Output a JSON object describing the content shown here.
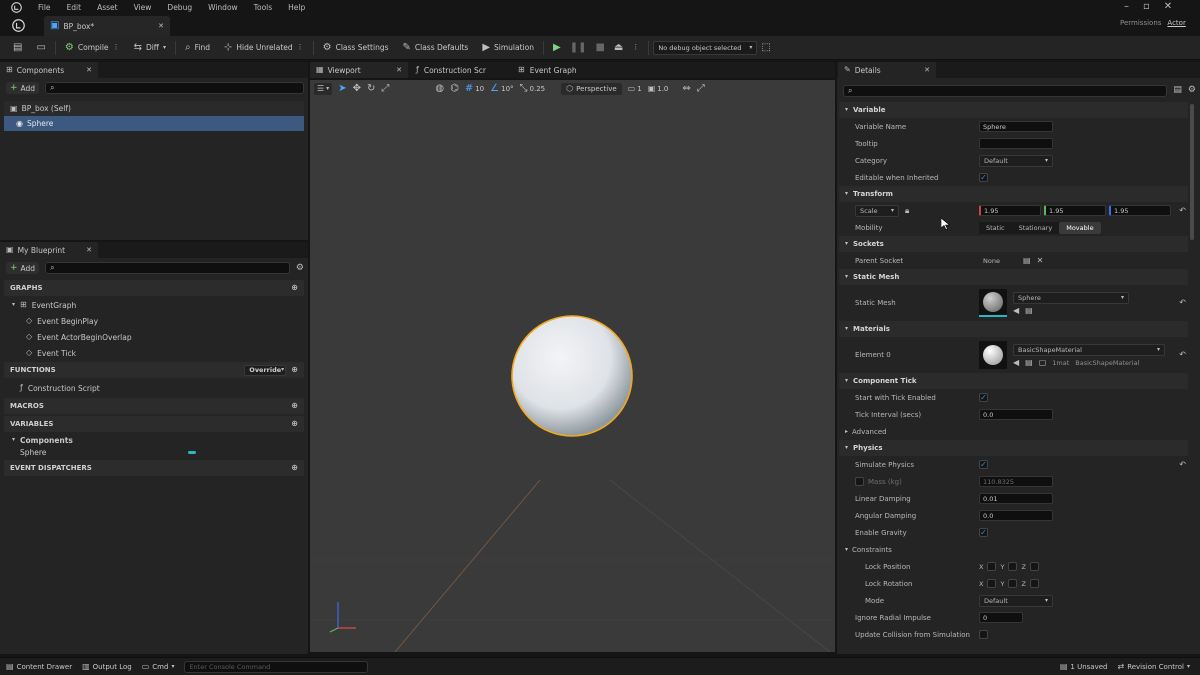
{
  "app": {
    "menu": [
      "File",
      "Edit",
      "Asset",
      "View",
      "Debug",
      "Window",
      "Tools",
      "Help"
    ],
    "doc_tab": "BP_box*",
    "user_label": "Permissions",
    "user_name": "Actor",
    "window_controls": [
      "minimize-icon",
      "maximize-icon",
      "close-icon"
    ]
  },
  "toolbar": {
    "compile": "Compile",
    "diff": "Diff",
    "find": "Find",
    "hide_unrelated": "Hide Unrelated",
    "class_settings": "Class Settings",
    "class_defaults": "Class Defaults",
    "simulation": "Simulation",
    "debug_object": "No debug object selected"
  },
  "components_panel": {
    "tab": "Components",
    "add": "Add",
    "items": [
      "BP_box (Self)",
      "Sphere"
    ]
  },
  "my_blueprint": {
    "tab": "My Blueprint",
    "add": "Add",
    "graphs": "GRAPHS",
    "event_graph": "EventGraph",
    "events": [
      "Event BeginPlay",
      "Event ActorBeginOverlap",
      "Event Tick"
    ],
    "functions": "FUNCTIONS",
    "functions_override": "Override",
    "construction_script": "Construction Script",
    "macros": "MACROS",
    "variables": "VARIABLES",
    "components_cat": "Components",
    "component_var": "Sphere",
    "event_dispatchers": "EVENT DISPATCHERS"
  },
  "editor_tabs": [
    "Viewport",
    "Construction Scr",
    "Event Graph"
  ],
  "viewport_toolbar": {
    "view_mode": "Perspective",
    "snap_grid": "10",
    "snap_angle": "10°",
    "snap_scale": "0.25",
    "camera_speed": "1",
    "fov": "1.0"
  },
  "details": {
    "tab": "Details",
    "sections": {
      "variable": "Variable",
      "transform": "Transform",
      "sockets": "Sockets",
      "static_mesh": "Static Mesh",
      "materials": "Materials",
      "component_tick": "Component Tick",
      "advanced": "Advanced",
      "physics": "Physics"
    },
    "variable_name_label": "Variable Name",
    "variable_name": "Sphere",
    "tooltip_label": "Tooltip",
    "category_label": "Category",
    "category": "Default",
    "editable_label": "Editable when Inherited",
    "scale_label": "Scale",
    "scale_x": "1.95",
    "scale_y": "1.95",
    "scale_z": "1.95",
    "mobility_label": "Mobility",
    "mobility_options": [
      "Static",
      "Stationary",
      "Movable"
    ],
    "parent_socket_label": "Parent Socket",
    "parent_socket": "None",
    "static_mesh_label": "Static Mesh",
    "static_mesh": "Sphere",
    "element_label": "Element 0",
    "material": "BasicShapeMaterial",
    "material_extra": "1mat",
    "material_id": "BasicShapeMaterial",
    "start_tick_label": "Start with Tick Enabled",
    "tick_interval_label": "Tick Interval (secs)",
    "tick_interval": "0.0",
    "simulate_label": "Simulate Physics",
    "mass_label": "Mass (kg)",
    "mass": "110.8325",
    "linear_damping_label": "Linear Damping",
    "linear_damping": "0.01",
    "angular_damping_label": "Angular Damping",
    "angular_damping": "0.0",
    "enable_gravity_label": "Enable Gravity",
    "constraints_label": "Constraints",
    "lock_position_label": "Lock Position",
    "lock_rotation_label": "Lock Rotation",
    "mode_label": "Mode",
    "mode": "Default",
    "xyz": [
      "X",
      "Y",
      "Z"
    ],
    "ignore_radial_impulse_label": "Ignore Radial Impulse",
    "ignore_radial_impulse": "0",
    "gravity_group_label": "Update Collision from Simulation"
  },
  "status": {
    "content_drawer": "Content Drawer",
    "output_log": "Output Log",
    "cmd": "Cmd",
    "cmd_placeholder": "Enter Console Command",
    "unsaved": "1 Unsaved",
    "revision_control": "Revision Control"
  }
}
